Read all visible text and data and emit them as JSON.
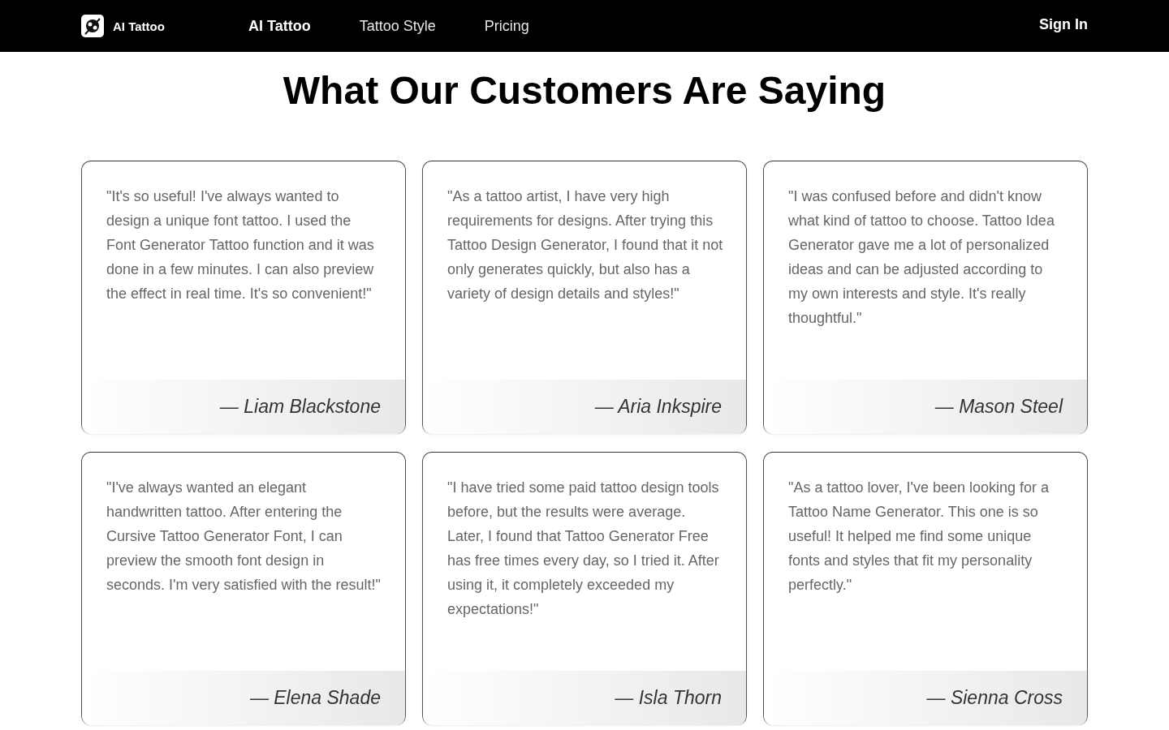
{
  "header": {
    "brand": "AI Tattoo",
    "nav": [
      {
        "label": "AI Tattoo",
        "selected": true
      },
      {
        "label": "Tattoo Style",
        "selected": false
      },
      {
        "label": "Pricing",
        "selected": false
      }
    ],
    "sign_in": "Sign In"
  },
  "title": "What Our Customers Are Saying",
  "testimonials": [
    {
      "quote": "\"It's so useful! I've always wanted to design a unique font tattoo. I used the Font Generator Tattoo function and it was done in a few minutes. I can also preview the effect in real time. It's so convenient!\"",
      "author": "— Liam Blackstone"
    },
    {
      "quote": "\"As a tattoo artist, I have very high requirements for designs. After trying this Tattoo Design Generator, I found that it not only generates quickly, but also has a variety of design details and styles!\"",
      "author": "— Aria Inkspire"
    },
    {
      "quote": "\"I was confused before and didn't know what kind of tattoo to choose. Tattoo Idea Generator gave me a lot of personalized ideas and can be adjusted according to my own interests and style. It's really thoughtful.\"",
      "author": "— Mason Steel"
    },
    {
      "quote": "\"I've always wanted an elegant handwritten tattoo. After entering the Cursive Tattoo Generator Font, I can preview the smooth font design in seconds. I'm very satisfied with the result!\"",
      "author": "— Elena Shade"
    },
    {
      "quote": "\"I have tried some paid tattoo design tools before, but the results were average. Later, I found that Tattoo Generator Free has free times every day, so I tried it. After using it, it completely exceeded my expectations!\"",
      "author": "— Isla Thorn"
    },
    {
      "quote": "\"As a tattoo lover, I've been looking for a Tattoo Name Generator. This one is so useful! It helped me find some unique fonts and styles that fit my personality perfectly.\"",
      "author": "— Sienna Cross"
    }
  ]
}
